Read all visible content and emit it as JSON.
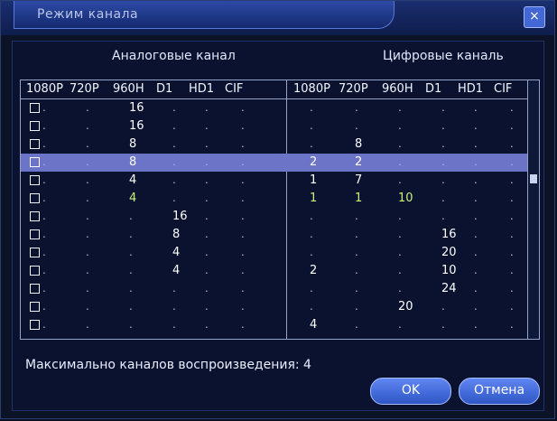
{
  "window": {
    "title": "Режим канала",
    "close_glyph": "×"
  },
  "groups": {
    "left": "Аналоговые канал",
    "right": "Цифровые каналь"
  },
  "table": {
    "left_headers": [
      "1080P",
      "720P",
      "960H",
      "D1",
      "HD1",
      "CIF"
    ],
    "right_headers": [
      "1080P",
      "720P",
      "960H",
      "D1",
      "HD1",
      "CIF"
    ],
    "rows": [
      {
        "left": [
          "",
          "",
          "16",
          "",
          "",
          ""
        ],
        "right": [
          "",
          "",
          "",
          "",
          "",
          ""
        ]
      },
      {
        "left": [
          "",
          "",
          "16",
          "",
          "",
          ""
        ],
        "right": [
          "",
          "",
          "",
          "",
          "",
          ""
        ]
      },
      {
        "left": [
          "",
          "",
          "8",
          "",
          "",
          ""
        ],
        "right": [
          "",
          "8",
          "",
          "",
          "",
          ""
        ]
      },
      {
        "left": [
          "",
          "",
          "8",
          "",
          "",
          ""
        ],
        "right": [
          "2",
          "2",
          "",
          "",
          "",
          ""
        ],
        "selected": true
      },
      {
        "left": [
          "",
          "",
          "4",
          "",
          "",
          ""
        ],
        "right": [
          "1",
          "7",
          "",
          "",
          "",
          ""
        ]
      },
      {
        "left": [
          "",
          "",
          "4",
          "",
          "",
          ""
        ],
        "right": [
          "1",
          "1",
          "10",
          "",
          "",
          ""
        ],
        "green": true
      },
      {
        "left": [
          "",
          "",
          "",
          "16",
          "",
          ""
        ],
        "right": [
          "",
          "",
          "",
          "",
          "",
          ""
        ]
      },
      {
        "left": [
          "",
          "",
          "",
          "8",
          "",
          ""
        ],
        "right": [
          "",
          "",
          "",
          "16",
          "",
          ""
        ]
      },
      {
        "left": [
          "",
          "",
          "",
          "4",
          "",
          ""
        ],
        "right": [
          "",
          "",
          "",
          "20",
          "",
          ""
        ]
      },
      {
        "left": [
          "",
          "",
          "",
          "4",
          "",
          ""
        ],
        "right": [
          "2",
          "",
          "",
          "10",
          "",
          ""
        ]
      },
      {
        "left": [
          "",
          "",
          "",
          "",
          "",
          ""
        ],
        "right": [
          "",
          "",
          "",
          "24",
          "",
          ""
        ]
      },
      {
        "left": [
          "",
          "",
          "",
          "",
          "",
          ""
        ],
        "right": [
          "",
          "",
          "20",
          "",
          "",
          ""
        ]
      },
      {
        "left": [
          "",
          "",
          "",
          "",
          "",
          ""
        ],
        "right": [
          "4",
          "",
          "",
          "",
          "",
          ""
        ]
      }
    ]
  },
  "footer": {
    "text": "Максимально каналов воспроизведения: 4"
  },
  "buttons": {
    "ok": "OK",
    "cancel": "Отмена"
  }
}
